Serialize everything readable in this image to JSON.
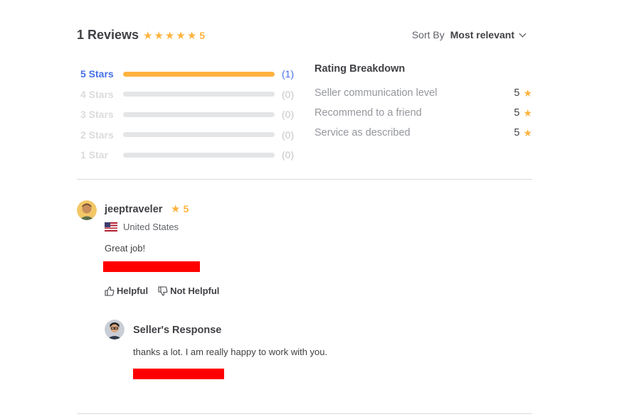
{
  "header": {
    "reviews_title": "1 Reviews",
    "overall_rating": "5",
    "overall_stars": 5,
    "sort_label": "Sort By",
    "sort_value": "Most relevant"
  },
  "rating_bars": [
    {
      "label": "5 Stars",
      "count": "(1)",
      "fraction": 1.0
    },
    {
      "label": "4 Stars",
      "count": "(0)",
      "fraction": 0
    },
    {
      "label": "3 Stars",
      "count": "(0)",
      "fraction": 0
    },
    {
      "label": "2 Stars",
      "count": "(0)",
      "fraction": 0
    },
    {
      "label": "1 Star",
      "count": "(0)",
      "fraction": 0
    }
  ],
  "breakdown": {
    "title": "Rating Breakdown",
    "items": [
      {
        "label": "Seller communication level",
        "value": "5"
      },
      {
        "label": "Recommend to a friend",
        "value": "5"
      },
      {
        "label": "Service as described",
        "value": "5"
      }
    ]
  },
  "review": {
    "username": "jeeptraveler",
    "rating": "5",
    "country": "United States",
    "text": "Great job!",
    "helpful_label": "Helpful",
    "not_helpful_label": "Not Helpful"
  },
  "seller_response": {
    "title": "Seller's Response",
    "text": "thanks a lot. I am really happy to work with you."
  },
  "colors": {
    "star": "#ffb33e",
    "active_link": "#446ee7",
    "redaction": "#ff0000"
  },
  "icons": [
    "star-icon",
    "chevron-down-icon",
    "us-flag-icon",
    "thumbs-up-icon",
    "thumbs-down-icon"
  ]
}
